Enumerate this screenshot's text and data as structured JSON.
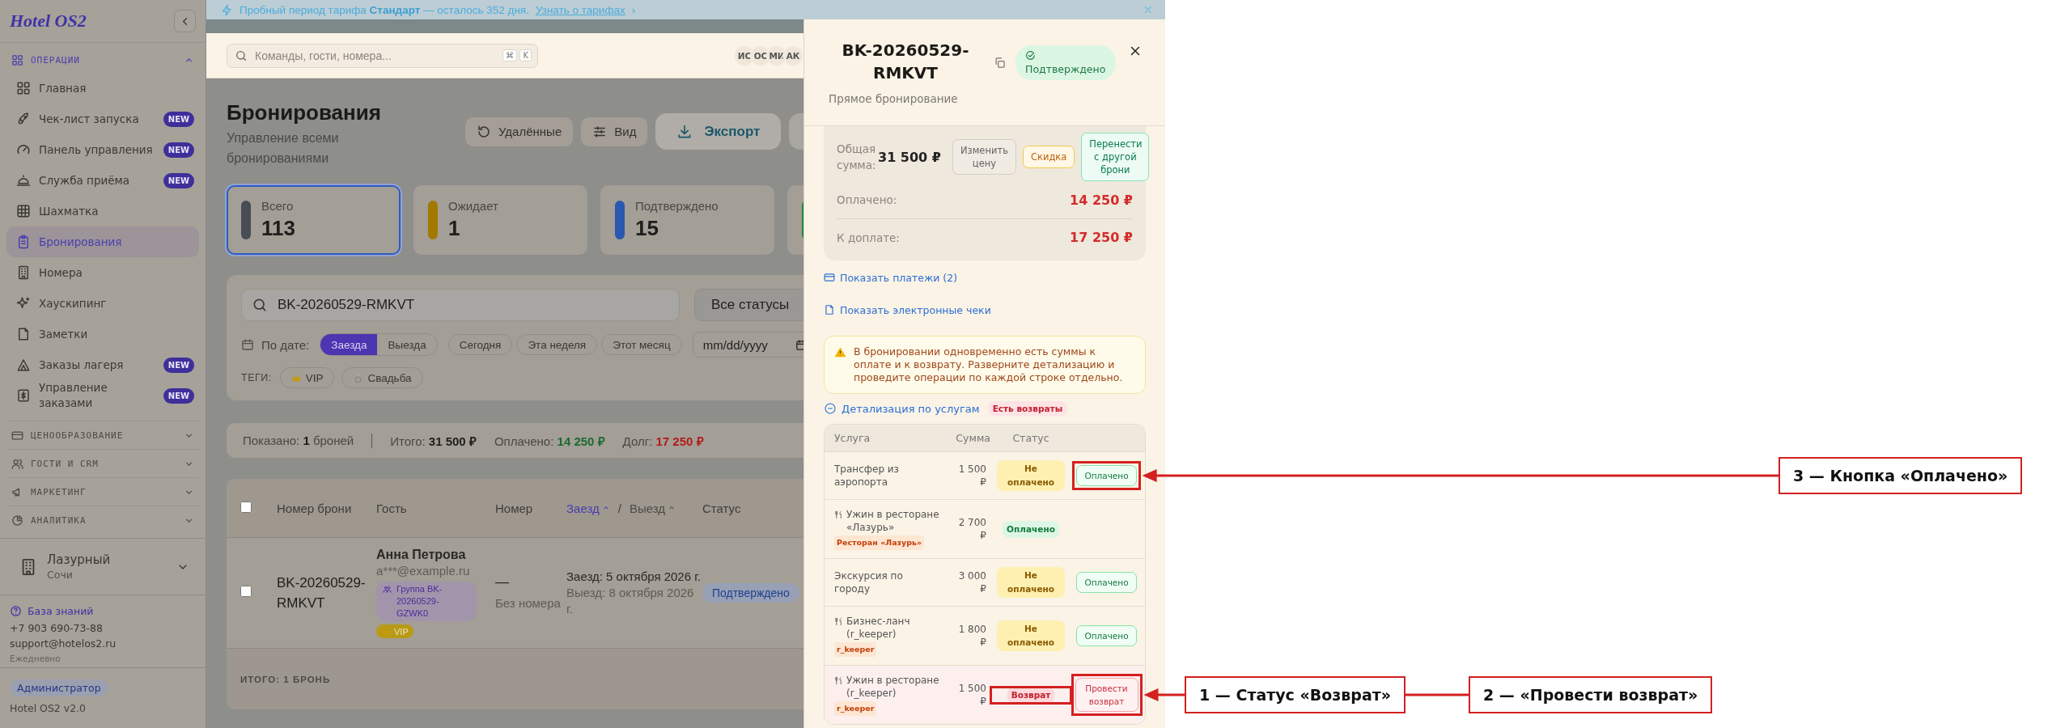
{
  "banner": {
    "text": "Пробный период тарифа **Стандарт** — осталось 352 дня.",
    "link": "Узнать о тарифах",
    "link_arrow": "›"
  },
  "sidebar": {
    "logo": "Hotel OS2",
    "sections": [
      {
        "title": "ОПЕРАЦИИ",
        "expanded": true,
        "items": [
          {
            "label": "Главная",
            "selected": false
          },
          {
            "label": "Чек-лист запуска",
            "badge": "NEW",
            "selected": false
          },
          {
            "label": "Панель управления",
            "badge": "NEW",
            "selected": false
          },
          {
            "label": "Служба приёма",
            "badge": "NEW",
            "selected": false
          },
          {
            "label": "Шахматка",
            "selected": false
          },
          {
            "label": "Бронирования",
            "selected": true
          },
          {
            "label": "Номера",
            "selected": false
          },
          {
            "label": "Хаускипинг",
            "selected": false
          },
          {
            "label": "Заметки",
            "selected": false
          },
          {
            "label": "Заказы лагеря",
            "badge": "NEW",
            "selected": false
          },
          {
            "label": "Управление заказами",
            "badge": "NEW",
            "selected": false
          }
        ]
      },
      {
        "title": "ЦЕНООБРАЗОВАНИЕ",
        "expanded": false
      },
      {
        "title": "ГОСТИ И CRM",
        "expanded": false
      },
      {
        "title": "МАРКЕТИНГ",
        "expanded": false
      },
      {
        "title": "АНАЛИТИКА",
        "expanded": false
      }
    ],
    "hotel": {
      "name": "Лазурный",
      "city": "Сочи"
    },
    "help": {
      "link": "База знаний",
      "phone": "+7 903 690-73-88",
      "email": "support@hotelos2.ru",
      "hours": "Ежедневно"
    },
    "user": {
      "role": "Администратор",
      "version": "Hotel OS2 v2.0"
    }
  },
  "topbar": {
    "search_placeholder": "Команды, гости, номера...",
    "shortcut": [
      "⌘",
      "K"
    ],
    "avatars": [
      "ИС",
      "ОС",
      "МИ",
      "АК"
    ]
  },
  "page": {
    "title": "Бронирования",
    "subtitle": "Управление всеми бронированиями",
    "actions": [
      {
        "label": "Удалённые",
        "kind": "deleted"
      },
      {
        "label": "Вид",
        "kind": "view"
      },
      {
        "label": "Экспорт",
        "kind": "export"
      }
    ]
  },
  "stats": [
    {
      "label": "Всего",
      "value": "113",
      "color": "#474c57",
      "selected": true
    },
    {
      "label": "Ожидает",
      "value": "1",
      "color": "#a37800",
      "selected": false
    },
    {
      "label": "Подтверждено",
      "value": "15",
      "color": "#2a58b0",
      "selected": false
    },
    {
      "color": "#1e8a3a",
      "selected": false
    }
  ],
  "filters": {
    "search": "BK-20260529-RMKVT",
    "status": "Все статусы",
    "date_label": "По дате:",
    "date_modes": [
      {
        "label": "Заезда",
        "selected": true
      },
      {
        "label": "Выезда",
        "selected": false
      }
    ],
    "ranges": [
      "Сегодня",
      "Эта неделя",
      "Этот месяц"
    ],
    "date_placeholder": "mm/dd/yyyy",
    "tags_label": "ТЕГИ:",
    "tags": [
      {
        "label": "VIP",
        "kind": "crown"
      },
      {
        "label": "Свадьба",
        "kind": "ring"
      }
    ]
  },
  "summary": {
    "shown": "Показано: **1** броней",
    "items": [
      {
        "label": "Итого:",
        "value": "31 500 ₽",
        "kind": "total"
      },
      {
        "label": "Оплачено:",
        "value": "14 250 ₽",
        "kind": "paid"
      },
      {
        "label": "Долг:",
        "value": "17 250 ₽",
        "kind": "debt"
      }
    ]
  },
  "bookings": {
    "select_all": false,
    "columns": [
      {
        "label": "Номер брони"
      },
      {
        "label": "Гость"
      },
      {
        "label": "Номер"
      },
      {
        "label": "Заезд",
        "sorted": true
      },
      {
        "label": "Выезд",
        "sorted": false
      },
      {
        "label": "Статус"
      }
    ],
    "date_separator": "/",
    "rows": [
      {
        "number": "BK-20260529-RMKVT",
        "guest": "Анна Петрова",
        "email": "a***@example.ru",
        "group": "Группа BK-20260529-GZWK0",
        "tags": [
          "VIP"
        ],
        "room": "—",
        "room_note": "Без номера",
        "checkin": "Заезд: 5 октября 2026 г.",
        "checkout": "Выезд: 8 октября 2026 г.",
        "status": "Подтверждено",
        "checked": false
      }
    ],
    "footer": "ИТОГО: 1 БРОНЬ"
  },
  "drawer": {
    "title": "BK-20260529-RMKVT",
    "status": "Подтверждено",
    "subtitle": "Прямое бронирование",
    "total_label": "Общая сумма:",
    "total": "31 500 ₽",
    "total_actions": [
      {
        "label": "Изменить цену",
        "kind": "neutral"
      },
      {
        "label": "Скидка",
        "kind": "warning"
      },
      {
        "label": "Перенести с другой брони",
        "kind": "success"
      }
    ],
    "amounts": [
      {
        "label": "Оплачено:",
        "value": "14 250 ₽"
      },
      {
        "label": "К доплате:",
        "value": "17 250 ₽"
      }
    ],
    "links": [
      {
        "label": "Показать платежи (2)",
        "kind": "card"
      },
      {
        "label": "Показать электронные чеки",
        "kind": "receipt"
      }
    ],
    "warning": "В бронировании одновременно есть суммы к оплате и к возврату. Разверните детализацию и проведите операции по каждой строке отдельно.",
    "details": {
      "label": "Детализация по услугам",
      "expanded": true,
      "badge": "Есть возвраты",
      "columns": [
        "Услуга",
        "Сумма",
        "Статус"
      ],
      "rows": [
        {
          "kind": "service",
          "service": "Трансфер из аэропорта",
          "amount": "1 500 ₽",
          "status": {
            "label": "Не оплачено",
            "kind": "unpaid"
          },
          "action": {
            "label": "Оплачено",
            "kind": "pay"
          }
        },
        {
          "kind": "restaurant",
          "service": "Ужин в ресторане «Лазурь»",
          "tag": "Ресторан «Лазурь»",
          "amount": "2 700 ₽",
          "status": {
            "label": "Оплачено",
            "kind": "paid"
          }
        },
        {
          "kind": "service",
          "service": "Экскурсия по городу",
          "amount": "3 000 ₽",
          "status": {
            "label": "Не оплачено",
            "kind": "unpaid"
          },
          "action": {
            "label": "Оплачено",
            "kind": "pay"
          }
        },
        {
          "kind": "restaurant",
          "service": "Бизнес-ланч (r_keeper)",
          "tag": "r_keeper",
          "amount": "1 800 ₽",
          "status": {
            "label": "Не оплачено",
            "kind": "unpaid"
          },
          "action": {
            "label": "Оплачено",
            "kind": "pay"
          }
        },
        {
          "kind": "restaurant",
          "service": "Ужин в ресторане (r_keeper)",
          "tag": "r_keeper",
          "amount": "1 500 ₽",
          "status": {
            "label": "Возврат",
            "kind": "refund"
          },
          "action": {
            "label": "Провести возврат",
            "kind": "refund"
          }
        }
      ]
    }
  },
  "annotations": [
    {
      "text": "3 — Кнопка «Оплачено»"
    },
    {
      "text": "1 — Статус «Возврат»"
    },
    {
      "text": "2 — «Провести возврат»"
    }
  ]
}
